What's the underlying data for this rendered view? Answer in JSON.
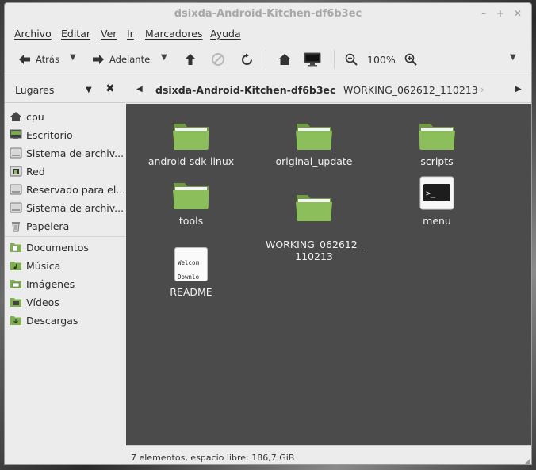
{
  "window": {
    "title": "dsixda-Android-Kitchen-df6b3ec"
  },
  "menu": [
    "Archivo",
    "Editar",
    "Ver",
    "Ir",
    "Marcadores",
    "Ayuda"
  ],
  "toolbar": {
    "back_label": "Atrás",
    "forward_label": "Adelante",
    "zoom": "100%"
  },
  "sidebar": {
    "title": "Lugares",
    "items": [
      {
        "label": "cpu",
        "icon": "home-icon"
      },
      {
        "label": "Escritorio",
        "icon": "desktop-icon"
      },
      {
        "label": "Sistema de archiv...",
        "icon": "drive-icon"
      },
      {
        "label": "Red",
        "icon": "network-icon"
      },
      {
        "label": "Reservado para el...",
        "icon": "drive-icon"
      },
      {
        "label": "Sistema de archiv...",
        "icon": "drive-icon"
      },
      {
        "label": "Papelera",
        "icon": "trash-icon"
      },
      {
        "label": "Documentos",
        "icon": "folder-icon"
      },
      {
        "label": "Música",
        "icon": "music-folder-icon"
      },
      {
        "label": "Imágenes",
        "icon": "pictures-folder-icon"
      },
      {
        "label": "Vídeos",
        "icon": "videos-folder-icon"
      },
      {
        "label": "Descargas",
        "icon": "downloads-folder-icon"
      }
    ]
  },
  "pathbar": {
    "current": "dsixda-Android-Kitchen-df6b3ec",
    "next": "WORKING_062612_110213"
  },
  "files": [
    {
      "name": "android-sdk-linux",
      "type": "folder"
    },
    {
      "name": "original_update",
      "type": "folder"
    },
    {
      "name": "scripts",
      "type": "folder"
    },
    {
      "name": "tools",
      "type": "folder"
    },
    {
      "name": "WORKING_062612_\n110213",
      "type": "folder"
    },
    {
      "name": "menu",
      "type": "terminal"
    },
    {
      "name": "README",
      "type": "text",
      "preview_line1": "Welcom",
      "preview_line2": "Downlo"
    }
  ],
  "status": {
    "text": "7 elementos, espacio libre: 186,7 GiB"
  },
  "colors": {
    "content_bg": "#4b4b4b",
    "folder_green": "#8cbf5b",
    "chrome_bg": "#ececec"
  }
}
